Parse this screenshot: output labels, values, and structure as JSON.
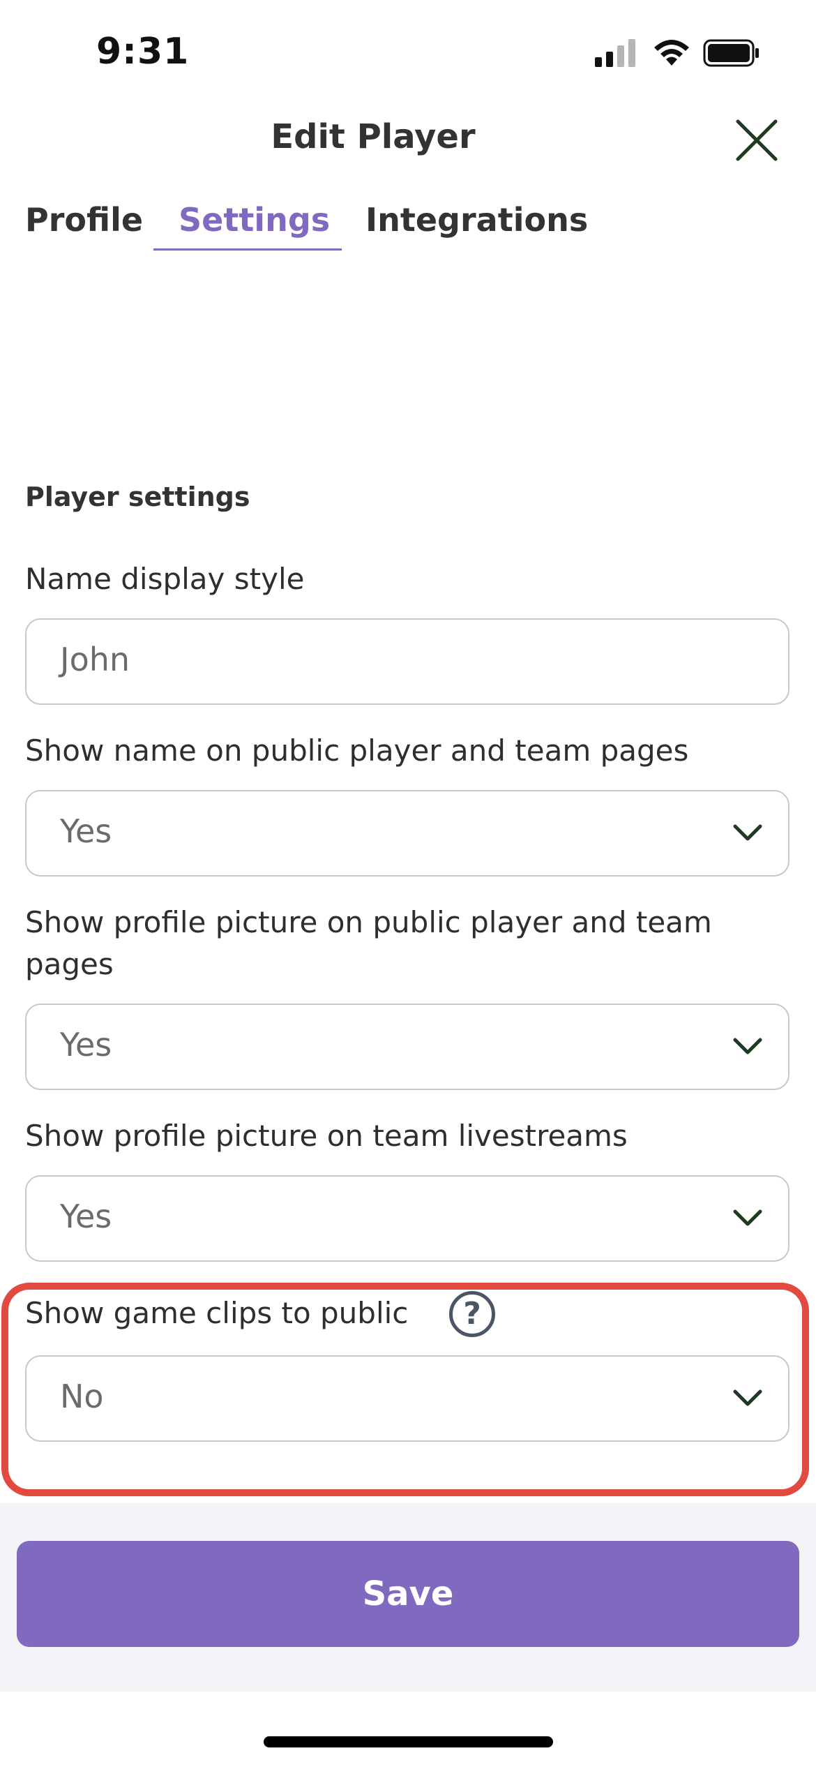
{
  "status_bar": {
    "time": "9:31"
  },
  "header": {
    "title": "Edit Player"
  },
  "tabs": [
    {
      "label": "Profile",
      "active": false
    },
    {
      "label": "Settings",
      "active": true
    },
    {
      "label": "Integrations",
      "active": false
    }
  ],
  "section": {
    "title": "Player settings"
  },
  "fields": [
    {
      "label": "Name display style",
      "placeholder": "John",
      "type": "text"
    },
    {
      "label": "Show name on public player and team pages",
      "value": "Yes",
      "type": "select"
    },
    {
      "label_line1": "Show profile picture on public player and team",
      "label_line2": "pages",
      "value": "Yes",
      "type": "select"
    },
    {
      "label": "Show profile picture on team livestreams",
      "value": "Yes",
      "type": "select"
    },
    {
      "label": "Show game clips to public",
      "value": "No",
      "type": "select",
      "help_icon": "?"
    }
  ],
  "footer": {
    "save_label": "Save"
  },
  "colors": {
    "accent": "#7f6abf",
    "highlight": "#e24a3f",
    "chevron": "#1f3a1f"
  }
}
